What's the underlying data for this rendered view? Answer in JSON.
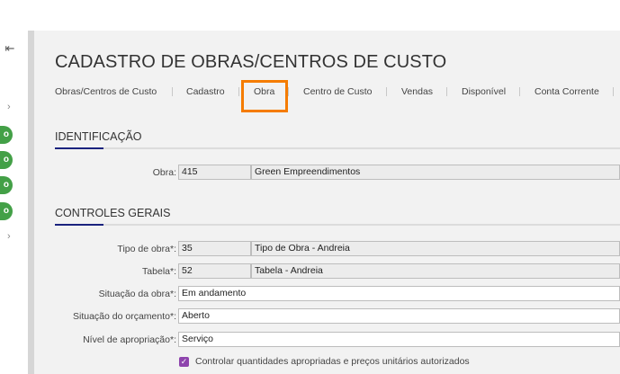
{
  "sidebar": {
    "collapse_icon": "⇤",
    "chevron": "›",
    "pill_label": "o"
  },
  "page": {
    "title": "CADASTRO DE OBRAS/CENTROS DE CUSTO"
  },
  "tabs": [
    {
      "label": "Obras/Centros de Custo"
    },
    {
      "label": "Cadastro"
    },
    {
      "label": "Obra"
    },
    {
      "label": "Centro de Custo"
    },
    {
      "label": "Vendas"
    },
    {
      "label": "Disponível"
    },
    {
      "label": "Conta Corrente"
    }
  ],
  "identificacao": {
    "heading": "IDENTIFICAÇÃO",
    "obra_label": "Obra:",
    "obra_code": "415",
    "obra_name": "Green Empreendimentos"
  },
  "controles": {
    "heading": "CONTROLES GERAIS",
    "tipo_label": "Tipo de obra*:",
    "tipo_code": "35",
    "tipo_name": "Tipo de Obra - Andreia",
    "tabela_label": "Tabela*:",
    "tabela_code": "52",
    "tabela_name": "Tabela - Andreia",
    "situacao_label": "Situação da obra*:",
    "situacao_value": "Em andamento",
    "orcamento_label": "Situação do orçamento*:",
    "orcamento_value": "Aberto",
    "nivel_label": "Nível de apropriação*:",
    "nivel_value": "Serviço",
    "checkbox_label": "Controlar quantidades apropriadas e preços unitários autorizados",
    "checkbox_mark": "✓"
  },
  "colors": {
    "accent": "#1a237e",
    "highlight": "#f57c00",
    "badge": "#43a047",
    "checkbox": "#8e44ad"
  }
}
